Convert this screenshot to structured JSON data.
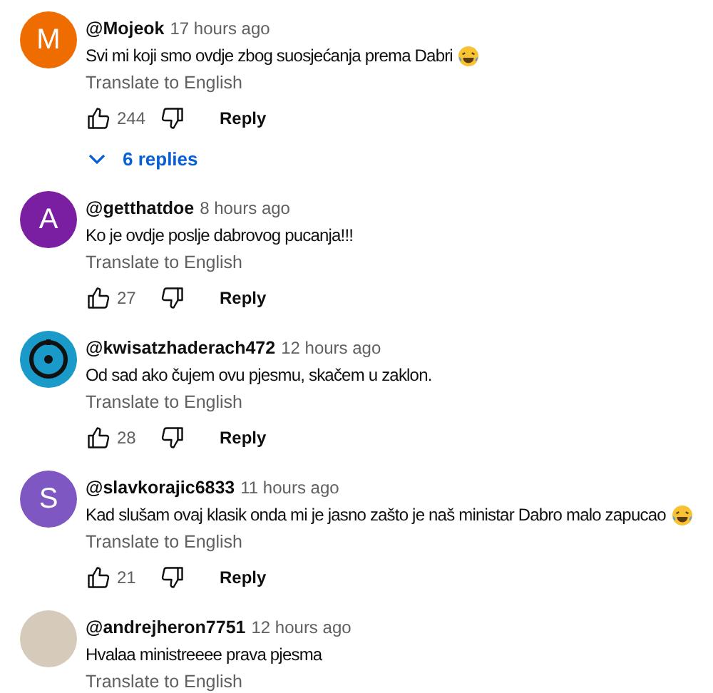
{
  "comments": [
    {
      "author": "@Mojeok",
      "time": "17 hours ago",
      "text": "Svi mi koji smo ovdje zbog suosjećanja prema Dabri",
      "emoji": true,
      "translate": "Translate to English",
      "likes": "244",
      "reply": "Reply",
      "replies": "6 replies",
      "avatar": {
        "kind": "letter",
        "letter": "M",
        "color": "#ef6c00"
      }
    },
    {
      "author": "@getthatdoe",
      "time": "8 hours ago",
      "text": "Ko je ovdje poslje dabrovog pucanja!!!",
      "emoji": false,
      "translate": "Translate to English",
      "likes": "27",
      "reply": "Reply",
      "avatar": {
        "kind": "letter",
        "letter": "A",
        "color": "#7b1fa2"
      }
    },
    {
      "author": "@kwisatzhaderach472",
      "time": "12 hours ago",
      "text": "Od sad ako čujem ovu pjesmu, skačem u zaklon.",
      "emoji": false,
      "translate": "Translate to English",
      "likes": "28",
      "reply": "Reply",
      "avatar": {
        "kind": "logo"
      }
    },
    {
      "author": "@slavkorajic6833",
      "time": "11 hours ago",
      "text": "Kad slušam ovaj klasik onda mi je jasno zašto je naš ministar Dabro malo zapucao",
      "emoji": true,
      "translate": "Translate to English",
      "likes": "21",
      "reply": "Reply",
      "avatar": {
        "kind": "letter",
        "letter": "S",
        "color": "#7e57c2"
      }
    },
    {
      "author": "@andrejheron7751",
      "time": "12 hours ago",
      "text": "Hvalaa ministreeee prava pjesma",
      "emoji": false,
      "translate": "Translate to English",
      "avatar": {
        "kind": "photo"
      }
    }
  ]
}
